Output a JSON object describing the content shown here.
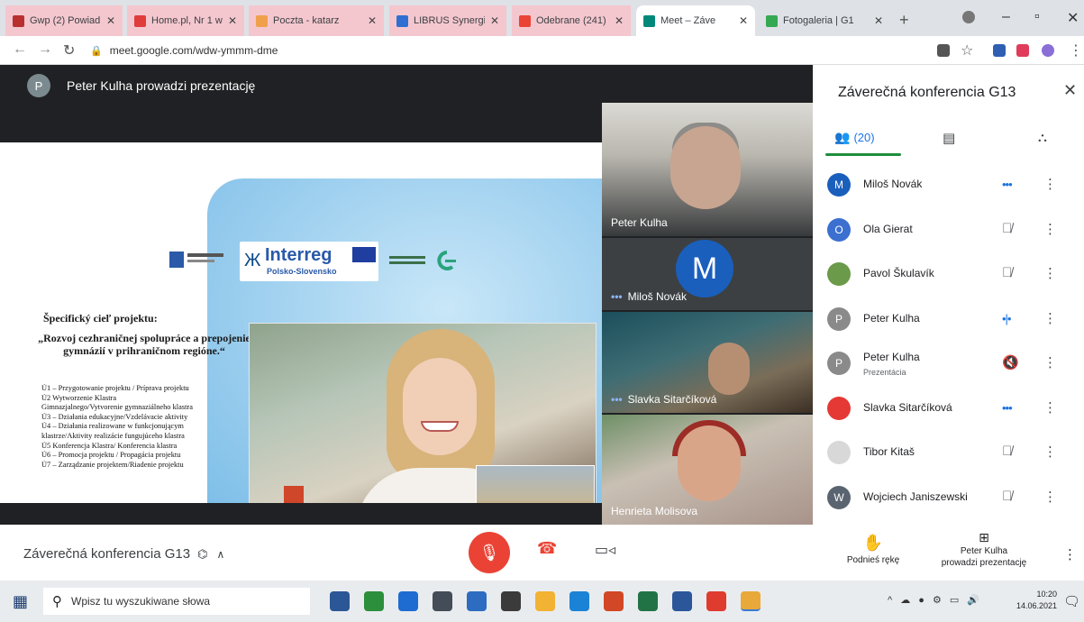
{
  "browser": {
    "tabs": [
      {
        "title": "Gwp (2) Powiad",
        "color": "#b8312f",
        "active": false,
        "pink": true
      },
      {
        "title": "Home.pl, Nr 1 w",
        "color": "#e03c3c",
        "active": false,
        "pink": true
      },
      {
        "title": "Poczta - katarz",
        "color": "#f0a04b",
        "active": false,
        "pink": true
      },
      {
        "title": "LIBRUS Synergia",
        "color": "#2f6fd1",
        "active": false,
        "pink": true
      },
      {
        "title": "Odebrane (241)",
        "color": "#ea4335",
        "active": false,
        "pink": true
      },
      {
        "title": "Meet – Záve",
        "color": "#00897b",
        "active": true,
        "pink": false
      },
      {
        "title": "Fotogaleria | G1",
        "color": "#34a853",
        "active": false,
        "pink": false
      }
    ],
    "new_tab": "+",
    "url": "meet.google.com/wdw-ymmm-dme"
  },
  "stage": {
    "presenter_initial": "P",
    "presenter_text": "Peter Kulha prowadzi prezentację",
    "slide": {
      "logo_left_text": "Fundusz Europejski",
      "interreg_name": "Interreg",
      "interreg_sub": "Polsko-Slovensko",
      "heading": "Špecifický cieľ projektu:",
      "quote": "„Rozvoj cezhraničnej spolupráce a prepojenie gymnázií v prihraničnom regióne.“",
      "list": [
        "Ú1 – Przygotowanie projektu / Príprava projektu",
        "Ú2   Wytworzenie Klastra",
        "Gimnazjalnego/Vytvorenie gymnaziálneho klastra",
        "Ú3 – Działania edukacyjne/Vzdelávacie aktivity",
        "Ú4 – Działania realizowane w funkcjonującym",
        "klastrze/Aktivity realizácie fungujúceho klastra",
        "Ú5   Konferencja Klastra/ Konferencia klastra",
        "Ú6 – Promocja projektu / Propagácia projektu",
        "Ú7 – Zarządzanie projektem/Riadenie projektu"
      ]
    },
    "tiles": [
      {
        "name": "Peter Kulha"
      },
      {
        "name": "Miloš Novák",
        "initial": "M"
      },
      {
        "name": "Slavka Sitarčíková"
      },
      {
        "name": "Henrieta Molisova"
      }
    ]
  },
  "panel": {
    "title": "Záverečná konferencia G13",
    "people_count": "(20)",
    "participants": [
      {
        "name": "Miloš Novák",
        "initial": "M",
        "color": "#1a5fbc",
        "status": "•••",
        "speaking": true
      },
      {
        "name": "Ola Gierat",
        "initial": "O",
        "color": "#3b6fd0",
        "status": "🎙̸",
        "speaking": false
      },
      {
        "name": "Pavol Škulavík",
        "initial": "",
        "color": "#6a9a4a",
        "status": "🎙̸",
        "speaking": false
      },
      {
        "name": "Peter Kulha",
        "initial": "P",
        "color": "#8a8a8a",
        "status": "•|•",
        "speaking": true
      },
      {
        "name": "Peter Kulha",
        "sub": "Prezentácia",
        "initial": "P",
        "color": "#8a8a8a",
        "status": "🔇",
        "speaking": false
      },
      {
        "name": "Slavka Sitarčíková",
        "initial": "",
        "color": "#e53935",
        "status": "•••",
        "speaking": true
      },
      {
        "name": "Tibor Kitaš",
        "initial": "",
        "color": "#d8d8d8",
        "status": "🎙̸",
        "speaking": false
      },
      {
        "name": "Wojciech Janiszewski",
        "initial": "W",
        "color": "#5a6470",
        "status": "🎙̸",
        "speaking": false
      }
    ]
  },
  "bottom": {
    "meeting_name": "Záverečná konferencia G13",
    "raise_hand": "Podnieś rękę",
    "present_line1": "Peter Kulha",
    "present_line2": "prowadzi prezentację"
  },
  "taskbar": {
    "search_placeholder": "Wpisz tu wyszukiwane słowa",
    "time": "10:20",
    "date": "14.06.2021",
    "icons": [
      {
        "color": "#2b5797"
      },
      {
        "color": "#2c8f3c"
      },
      {
        "color": "#1e6cd1"
      },
      {
        "color": "#444c57"
      },
      {
        "color": "#2d6cc0"
      },
      {
        "color": "#3b3b3b"
      },
      {
        "color": "#f2b233"
      },
      {
        "color": "#1b83d6"
      },
      {
        "color": "#d24726"
      },
      {
        "color": "#217346"
      },
      {
        "color": "#2b579a"
      },
      {
        "color": "#e03b2f"
      },
      {
        "color": "#e8a93a"
      }
    ]
  }
}
